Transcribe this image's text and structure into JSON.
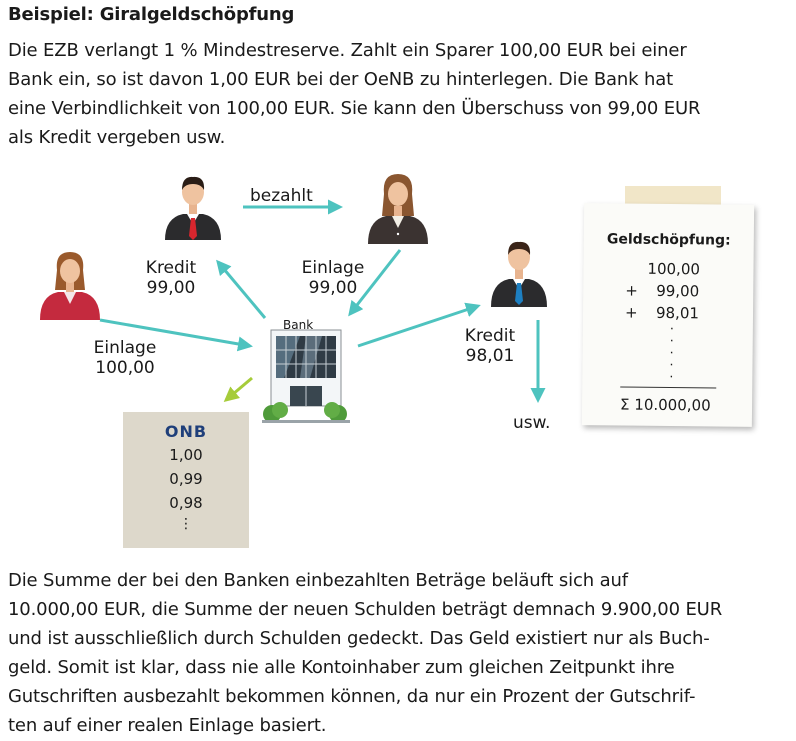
{
  "title": "Beispiel: Giralgeldschöpfung",
  "intro_lines": [
    "Die EZB verlangt 1 % Mindestreserve. Zahlt ein Sparer 100,00 EUR bei einer",
    "Bank ein, so ist davon 1,00 EUR bei der OeNB zu hinterlegen. Die Bank hat",
    "eine Verbindlichkeit von 100,00  EUR. Sie kann den Überschuss von 99,00 EUR",
    "als Kredit vergeben usw."
  ],
  "diagram": {
    "paid_label": "bezahlt",
    "credit_label": "Kredit",
    "credit_1": "99,00",
    "deposit_label": "Einlage",
    "deposit_2": "99,00",
    "deposit_1": "100,00",
    "bank_label": "Bank",
    "credit_2": "98,01",
    "etc_label": "usw.",
    "onb": {
      "logo_text": "ONB",
      "values": [
        "1,00",
        "0,99",
        "0,98"
      ],
      "more": "⋮"
    },
    "note": {
      "title": "Geldschöpfung:",
      "first": "100,00",
      "plus": "+",
      "second": "99,00",
      "third": "98,01",
      "sum_symbol": "Σ",
      "sum": "10.000,00"
    },
    "colors": {
      "arrow": "#4ec3bf",
      "arrow_onb": "#a6cc3a",
      "onb_box": "#ddd8cb",
      "onb_logo": "#1f3f7a",
      "tie_red": "#d8262e",
      "tie_blue": "#1d7fc1",
      "woman_red": "#c42a3e"
    },
    "icons": [
      "businessman-red-tie-icon",
      "businesswoman-icon",
      "woman-red-jacket-icon",
      "businessman-blue-tie-icon",
      "bank-building-icon"
    ]
  },
  "outro_lines": [
    "Die Summe der bei den Banken einbezahlten Beträge beläuft sich auf",
    "10.000,00 EUR, die Summe der neuen Schulden beträgt demnach 9.900,00 EUR",
    "und ist ausschließlich durch Schulden gedeckt. Das Geld existiert nur als Buch-",
    "geld. Somit ist klar, dass nie alle Kontoinhaber zum gleichen Zeitpunkt ihre",
    "Gutschriften ausbezahlt bekommen können, da nur ein Prozent der Gutschrif-",
    "ten auf einer realen Einlage basiert."
  ]
}
